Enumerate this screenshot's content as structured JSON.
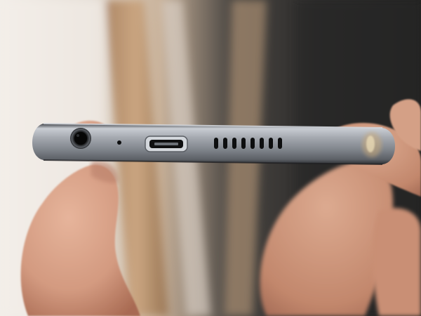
{
  "scene": {
    "subject": "phone-bottom-edge",
    "ports": [
      "headphone-jack",
      "microphone-hole",
      "micro-usb-port",
      "speaker-grille"
    ],
    "speaker_slot_count": 9,
    "colors": {
      "phone_body": "#8d9198",
      "phone_body_highlight": "#c9cdd3",
      "skin": "#d9a58c",
      "skin_shadow": "#b67b62",
      "background_light": "#e8e2da",
      "background_dark": "#2b2a29",
      "wood": "#b58a62",
      "port_dark": "#151617"
    }
  }
}
